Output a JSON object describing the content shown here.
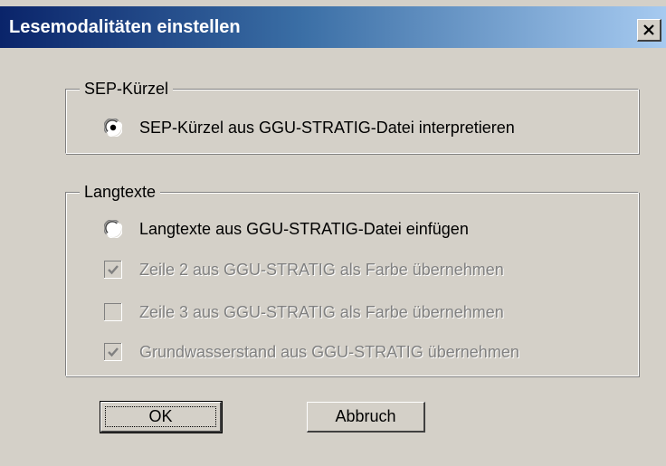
{
  "dialog": {
    "title": "Lesemodalitäten einstellen",
    "close_symbol": "✕"
  },
  "groups": {
    "sep": {
      "legend": "SEP-Kürzel",
      "option_label": "SEP-Kürzel aus GGU-STRATIG-Datei interpretieren",
      "option_selected": true
    },
    "langtexte": {
      "legend": "Langtexte",
      "radio_label": "Langtexte aus GGU-STRATIG-Datei einfügen",
      "radio_selected": false,
      "checkboxes": [
        {
          "label": "Zeile 2 aus GGU-STRATIG als Farbe übernehmen",
          "checked": true,
          "enabled": false
        },
        {
          "label": "Zeile 3 aus GGU-STRATIG als Farbe übernehmen",
          "checked": false,
          "enabled": false
        },
        {
          "label": "Grundwasserstand aus GGU-STRATIG übernehmen",
          "checked": true,
          "enabled": false
        }
      ]
    }
  },
  "buttons": {
    "ok": "OK",
    "cancel": "Abbruch"
  },
  "colors": {
    "face": "#d4d0c8",
    "title_start": "#0a246a",
    "title_end": "#a6caf0",
    "disabled_text": "#808080"
  },
  "icons": {
    "close": "close-icon",
    "radio_selected": "radio-selected-icon",
    "radio_empty": "radio-empty-icon",
    "checkbox_checked": "checkbox-checked-icon",
    "checkbox_empty": "checkbox-empty-icon"
  }
}
